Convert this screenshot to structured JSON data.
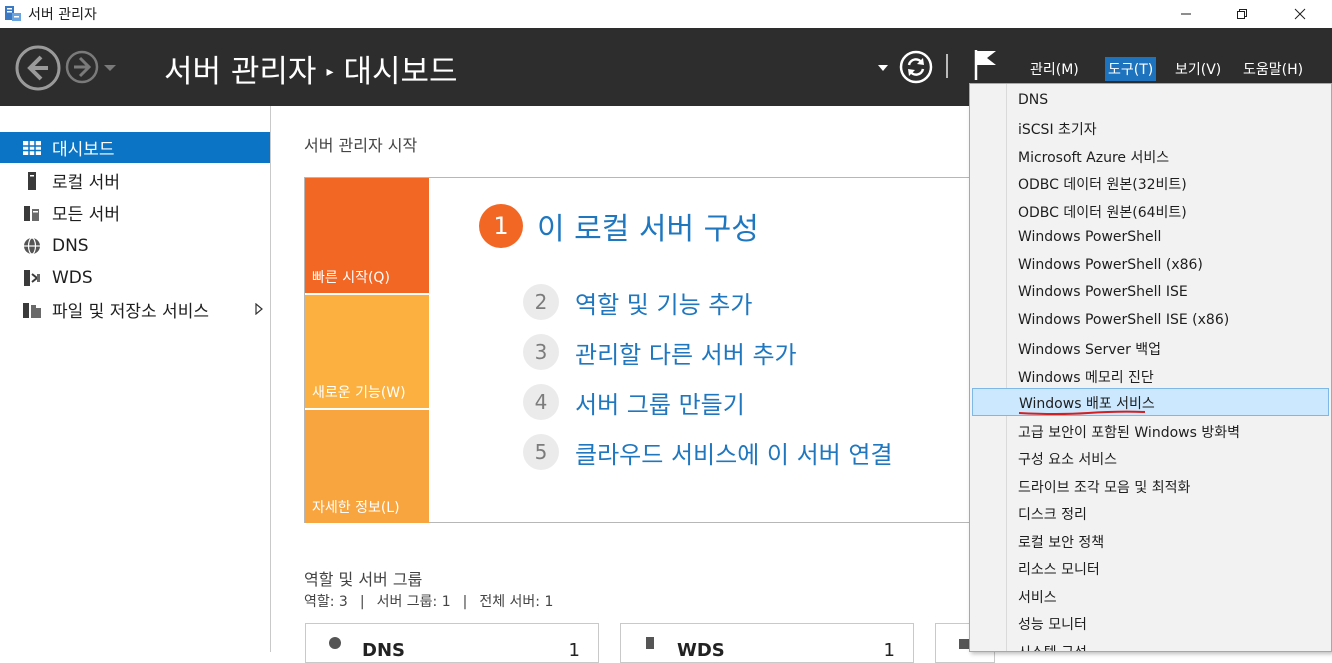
{
  "window": {
    "title": "서버 관리자"
  },
  "header": {
    "breadcrumb_root": "서버 관리자",
    "breadcrumb_separator": "▸",
    "breadcrumb_page": "대시보드",
    "menus": [
      {
        "label": "관리(M)"
      },
      {
        "label": "도구(T)",
        "active": true
      },
      {
        "label": "보기(V)"
      },
      {
        "label": "도움말(H)"
      }
    ]
  },
  "sidebar": {
    "items": [
      {
        "label": "대시보드",
        "icon": "dashboard-icon",
        "selected": true
      },
      {
        "label": "로컬 서버",
        "icon": "local-server-icon"
      },
      {
        "label": "모든 서버",
        "icon": "all-servers-icon"
      },
      {
        "label": "DNS",
        "icon": "dns-icon"
      },
      {
        "label": "WDS",
        "icon": "wds-icon"
      },
      {
        "label": "파일 및 저장소 서비스",
        "icon": "file-storage-icon",
        "has_submenu": true
      }
    ]
  },
  "welcome": {
    "title": "서버 관리자 시작",
    "tiles": [
      {
        "label": "빠른 시작(Q)",
        "color": "#f26724"
      },
      {
        "label": "새로운 기능(W)",
        "color": "#fbb040"
      },
      {
        "label": "자세한 정보(L)",
        "color": "#f9a53f"
      }
    ],
    "steps": [
      {
        "num": "1",
        "label": "이 로컬 서버 구성"
      },
      {
        "num": "2",
        "label": "역할 및 기능 추가"
      },
      {
        "num": "3",
        "label": "관리할 다른 서버 추가"
      },
      {
        "num": "4",
        "label": "서버 그룹 만들기"
      },
      {
        "num": "5",
        "label": "클라우드 서비스에 이 서버 연결"
      }
    ]
  },
  "roles": {
    "title": "역할 및 서버 그룹",
    "summary_roles": "역할: 3",
    "summary_groups": "서버 그룹: 1",
    "summary_servers": "전체 서버: 1",
    "cards": [
      {
        "name": "DNS",
        "count": "1"
      },
      {
        "name": "WDS",
        "count": "1"
      }
    ]
  },
  "tools_menu": {
    "items": [
      {
        "label": "DNS"
      },
      {
        "label": "iSCSI 초기자"
      },
      {
        "label": "Microsoft Azure 서비스"
      },
      {
        "label": "ODBC 데이터 원본(32비트)"
      },
      {
        "label": "ODBC 데이터 원본(64비트)"
      },
      {
        "label": "Windows PowerShell"
      },
      {
        "label": "Windows PowerShell (x86)"
      },
      {
        "label": "Windows PowerShell ISE"
      },
      {
        "label": "Windows PowerShell ISE (x86)"
      },
      {
        "label": "Windows Server 백업"
      },
      {
        "label": "Windows 메모리 진단"
      },
      {
        "label": "Windows 배포 서비스",
        "highlighted": true
      },
      {
        "label": "고급 보안이 포함된 Windows 방화벽"
      },
      {
        "label": "구성 요소 서비스"
      },
      {
        "label": "드라이브 조각 모음 및 최적화"
      },
      {
        "label": "디스크 정리"
      },
      {
        "label": "로컬 보안 정책"
      },
      {
        "label": "리소스 모니터"
      },
      {
        "label": "서비스"
      },
      {
        "label": "성능 모니터"
      },
      {
        "label": "시스템 구성"
      }
    ]
  },
  "colors": {
    "header_bg": "#2d2d2d",
    "accent": "#1e73be",
    "link": "#1f77bf",
    "highlight_bg": "#cce8ff",
    "annotation": "#d21f1f"
  }
}
